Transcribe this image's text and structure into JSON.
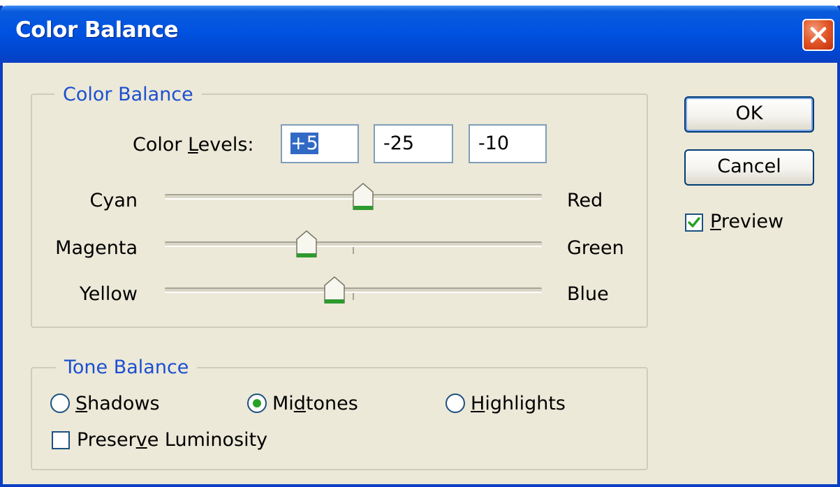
{
  "window": {
    "title": "Color Balance"
  },
  "color_balance": {
    "group_label": "Color Balance",
    "levels_label_pre": "Color ",
    "levels_label_u": "L",
    "levels_label_post": "evels:",
    "levels": [
      "+5",
      "-25",
      "-10"
    ],
    "sliders": [
      {
        "left": "Cyan",
        "right": "Red",
        "value": 5,
        "min": -100,
        "max": 100
      },
      {
        "left": "Magenta",
        "right": "Green",
        "value": -25,
        "min": -100,
        "max": 100
      },
      {
        "left": "Yellow",
        "right": "Blue",
        "value": -10,
        "min": -100,
        "max": 100
      }
    ]
  },
  "tone_balance": {
    "group_label": "Tone Balance",
    "options": [
      {
        "u": "S",
        "rest": "hadows",
        "pre": "",
        "selected": false
      },
      {
        "pre": "Mi",
        "u": "d",
        "rest": "tones",
        "selected": true
      },
      {
        "u": "H",
        "rest": "ighlights",
        "pre": "",
        "selected": false
      }
    ],
    "preserve_pre": "Preser",
    "preserve_u": "v",
    "preserve_post": "e Luminosity",
    "preserve_checked": false
  },
  "buttons": {
    "ok": "OK",
    "cancel": "Cancel"
  },
  "preview": {
    "u": "P",
    "rest": "review",
    "checked": true
  },
  "colors": {
    "accent": "#1c4fd0",
    "title_bar": "#0053e1",
    "thumb_base": "#2e9a2e",
    "check": "#27a227"
  }
}
